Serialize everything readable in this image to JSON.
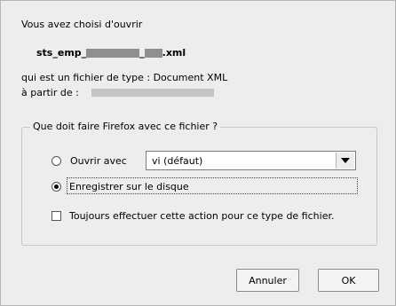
{
  "dialog": {
    "intro": "Vous avez choisi d'ouvrir",
    "filename_prefix": "sts_emp_",
    "filename_middle": "_",
    "filename_suffix": ".xml",
    "filetype": "qui est un fichier de type : Document XML",
    "source_label": "à partir de :"
  },
  "group": {
    "legend": "Que doit faire Firefox avec ce fichier ?",
    "open_with_label": "Ouvrir avec",
    "open_with_value": "vi (défaut)",
    "save_label": "Enregistrer sur le disque",
    "always_label": "Toujours effectuer cette action pour ce type de fichier."
  },
  "buttons": {
    "cancel": "Annuler",
    "ok": "OK"
  },
  "state": {
    "selected_option": "save",
    "always_checked": false
  }
}
